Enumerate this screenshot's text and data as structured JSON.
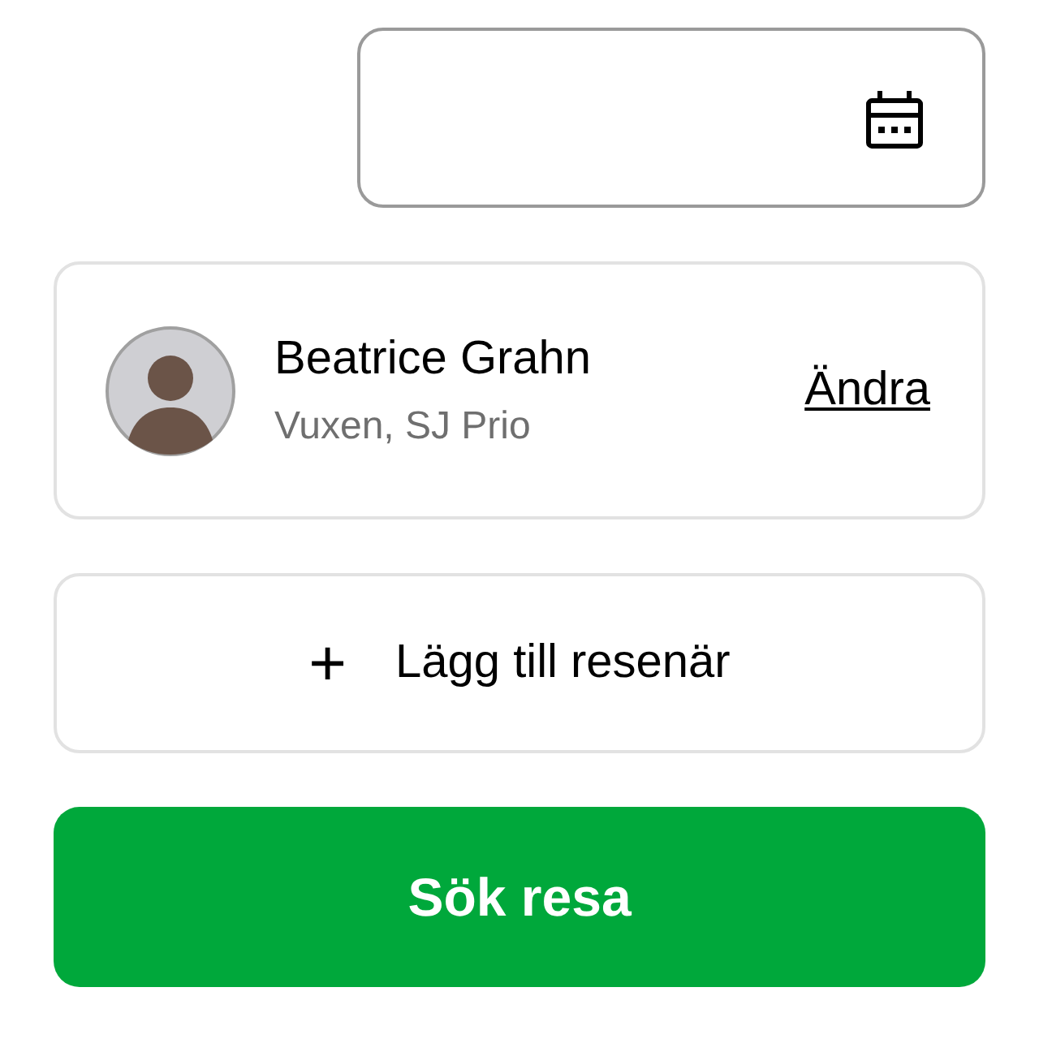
{
  "date_field": {
    "kind": "date"
  },
  "traveler": {
    "name": "Beatrice Grahn",
    "details": "Vuxen, SJ Prio",
    "edit_link": "Ändra"
  },
  "add_traveler_button": {
    "icon": "+",
    "label": "Lägg till resenär"
  },
  "search_button": {
    "label": "Sök resa"
  }
}
